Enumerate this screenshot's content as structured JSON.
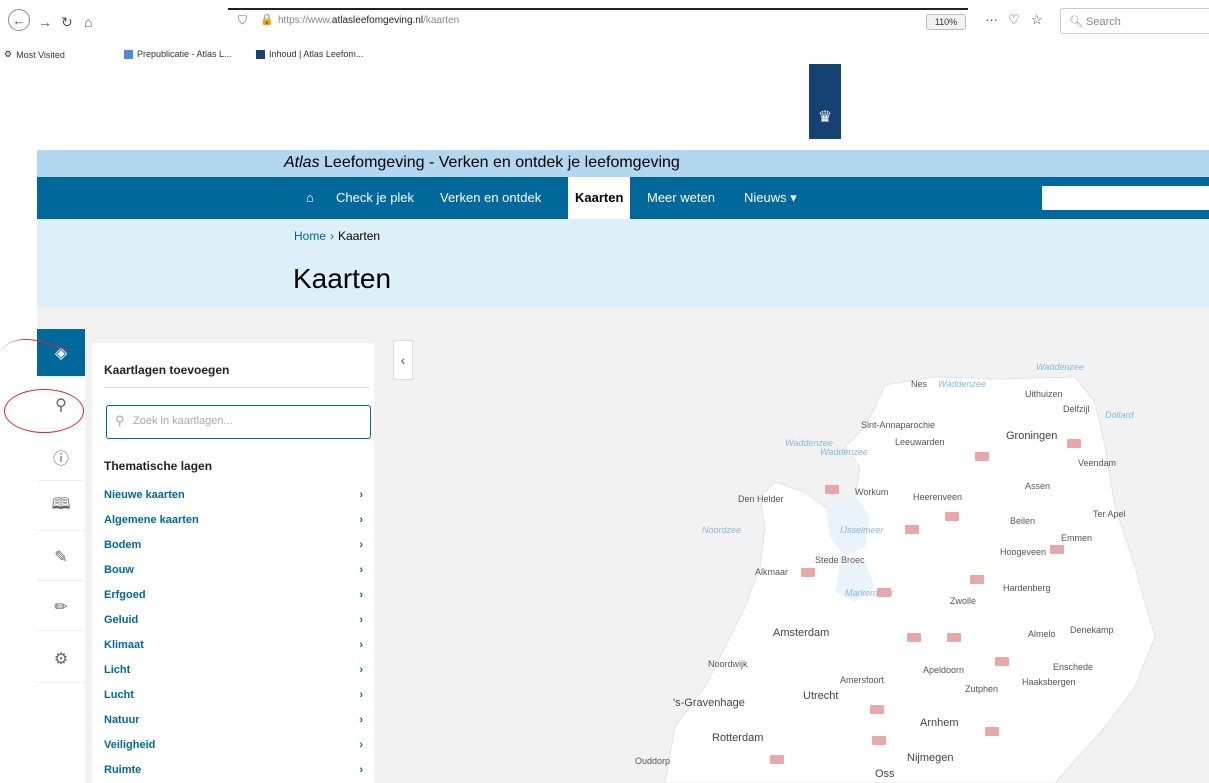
{
  "browser": {
    "url_prefix": "https://www.",
    "url_domain": "atlasleefomgeving.nl",
    "url_path": "/kaarten",
    "zoom": "110%",
    "search_placeholder": "Search",
    "bookmarks": [
      "Most Visited",
      "Prepublicatie - Atlas L...",
      "Inhoud | Atlas Leefom..."
    ]
  },
  "site": {
    "title_italic": "Atlas",
    "title_rest": " Leefomgeving - Verken en ontdek je leefomgeving",
    "nav": [
      "Check je plek",
      "Verken en ontdek",
      "Kaarten",
      "Meer weten",
      "Nieuws ▾"
    ],
    "breadcrumb_home": "Home",
    "breadcrumb_current": "Kaarten",
    "page_title": "Kaarten"
  },
  "panel": {
    "title": "Kaartlagen toevoegen",
    "search_placeholder": "Zoek in kaartlagen...",
    "section": "Thematische lagen",
    "layers": [
      "Nieuwe kaarten",
      "Algemene kaarten",
      "Bodem",
      "Bouw",
      "Erfgoed",
      "Geluid",
      "Klimaat",
      "Licht",
      "Lucht",
      "Natuur",
      "Veiligheid",
      "Ruimte"
    ]
  },
  "map_labels": {
    "waddenzee1": "Waddenzee",
    "waddenzee2": "Waddenzee",
    "waddenzee3": "Waddenzee",
    "waddenzee4": "Waddenzee",
    "nes": "Nes",
    "uithuizen": "Uithuizen",
    "delfzijl": "Delfzijl",
    "dollard": "Dollard",
    "sint_annaparochie": "Sint-Annaparochie",
    "leeuwarden": "Leeuwarden",
    "groningen": "Groningen",
    "veendam": "Veendam",
    "assen": "Assen",
    "den_helder": "Den Helder",
    "workum": "Workum",
    "heerenveen": "Heerenveen",
    "beilen": "Beilen",
    "ter_apel": "Ter Apel",
    "noordzee": "Noordzee",
    "ijsselmeer": "IJsselmeer",
    "emmen": "Emmen",
    "hoogeveen": "Hoogeveen",
    "stede_broec": "Stede Broec",
    "alkmaar": "Alkmaar",
    "hardenberg": "Hardenberg",
    "markermeer": "Markermeer",
    "zwolle": "Zwolle",
    "amsterdam": "Amsterdam",
    "almelo": "Almelo",
    "denekamp": "Denekamp",
    "noordwijk": "Noordwijk",
    "apeldoorn": "Apeldoorn",
    "enschede": "Enschede",
    "amersfoort": "Amersfoort",
    "zutphen": "Zutphen",
    "haaksbergen": "Haaksbergen",
    "utrecht": "Utrecht",
    "s_gravenhage": "'s-Gravenhage",
    "arnhem": "Arnhem",
    "rotterdam": "Rotterdam",
    "ouddorp": "Ouddorp",
    "nijmegen": "Nijmegen",
    "oss": "Oss"
  }
}
